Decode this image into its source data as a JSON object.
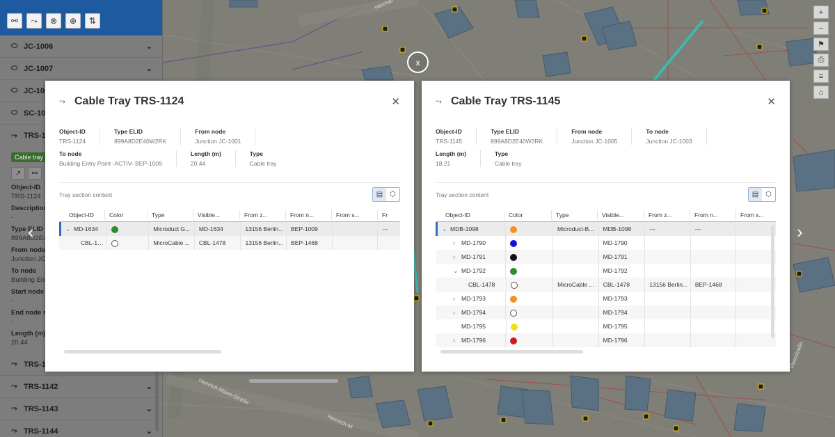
{
  "toolbar": {
    "icons": [
      "binoculars-icon",
      "route-icon",
      "cancel-icon",
      "zoom-in-icon",
      "sort-icon"
    ]
  },
  "sidebar": {
    "items_top": [
      {
        "label": "JC-1006"
      },
      {
        "label": "JC-1007"
      },
      {
        "label": "JC-100"
      },
      {
        "label": "SC-108"
      }
    ],
    "active_item": {
      "label": "TRS-11",
      "badge": "Cable tray"
    },
    "fields": [
      {
        "label": "Object-ID",
        "value": "TRS-1124"
      },
      {
        "label": "Description",
        "value": "-"
      },
      {
        "label": "Type ELID",
        "value": "899A8D2E4"
      },
      {
        "label": "From node",
        "value": "Junction JC"
      },
      {
        "label": "To node",
        "value": "Building Ent"
      },
      {
        "label": "Start node s",
        "value": "-"
      },
      {
        "label": "End node si",
        "value": "-"
      },
      {
        "label": "Length (m)",
        "value": "20.44"
      }
    ],
    "items_bottom": [
      {
        "label": "TRS-11"
      },
      {
        "label": "TRS-1142"
      },
      {
        "label": "TRS-1143"
      },
      {
        "label": "TRS-1144"
      }
    ]
  },
  "map": {
    "close_label": "x",
    "streets": [
      "Herman",
      "Heinrich-Mann-Straße",
      "Heinrich-M",
      "Pleinstraße"
    ]
  },
  "dialog1": {
    "title": "Cable Tray TRS-1124",
    "props": [
      {
        "k": "Object-ID",
        "v": "TRS-1124"
      },
      {
        "k": "Type ELID",
        "v": "899A8D2E40W2RK"
      },
      {
        "k": "From node",
        "v": "Junction JC-1001"
      },
      {
        "k": "To node",
        "v": "Building Entry Point -ACTIV- BEP-1009"
      },
      {
        "k": "Length (m)",
        "v": "20.44"
      },
      {
        "k": "Type",
        "v": "Cable tray"
      }
    ],
    "section_label": "Tray section content",
    "columns": [
      "Object-ID",
      "Color",
      "Type",
      "Visible...",
      "From z...",
      "From n...",
      "From s...",
      "Fr"
    ],
    "rows": [
      {
        "id": "MD-1634",
        "color": "#2e8b2e",
        "type": "Microduct G...",
        "visible": "MD-1634",
        "fromz": "13156 Berlin...",
        "fromn": "BEP-1009",
        "froms": "",
        "fr": "---",
        "toggle": "⌄"
      },
      {
        "id": "CBL-1478",
        "color": "#ffffff",
        "type": "MicroCable ...",
        "visible": "CBL-1478",
        "fromz": "13156 Berlin...",
        "fromn": "BEP-1468",
        "froms": "",
        "fr": "",
        "toggle": ""
      }
    ]
  },
  "dialog2": {
    "title": "Cable Tray TRS-1145",
    "props": [
      {
        "k": "Object-ID",
        "v": "TRS-1145"
      },
      {
        "k": "Type ELID",
        "v": "899A8D2E40W2RK"
      },
      {
        "k": "From node",
        "v": "Junction JC-1005"
      },
      {
        "k": "To node",
        "v": "Junction JC-1003"
      },
      {
        "k": "Length (m)",
        "v": "18.21"
      },
      {
        "k": "Type",
        "v": "Cable tray"
      }
    ],
    "section_label": "Tray section content",
    "columns": [
      "Object-ID",
      "Color",
      "Type",
      "Visible...",
      "From z...",
      "From n...",
      "From s..."
    ],
    "rows": [
      {
        "id": "MDB-1098",
        "color": "#f0922a",
        "type": "Microduct-B...",
        "visible": "MDB-1098",
        "fromz": "---",
        "fromn": "---",
        "froms": "",
        "toggle": "⌄"
      },
      {
        "id": "MD-1790",
        "color": "#1212e0",
        "type": "",
        "visible": "MD-1790",
        "fromz": "",
        "fromn": "",
        "froms": "",
        "toggle": "›"
      },
      {
        "id": "MD-1791",
        "color": "#111111",
        "type": "",
        "visible": "MD-1791",
        "fromz": "",
        "fromn": "",
        "froms": "",
        "toggle": "›"
      },
      {
        "id": "MD-1792",
        "color": "#2e8b2e",
        "type": "",
        "visible": "MD-1792",
        "fromz": "",
        "fromn": "",
        "froms": "",
        "toggle": "⌄"
      },
      {
        "id": "CBL-1478",
        "color": "#ffffff",
        "type": "MicroCable ...",
        "visible": "CBL-1478",
        "fromz": "13156 Berlin...",
        "fromn": "BEP-1468",
        "froms": "",
        "toggle": ""
      },
      {
        "id": "MD-1793",
        "color": "#f0922a",
        "type": "",
        "visible": "MD-1793",
        "fromz": "",
        "fromn": "",
        "froms": "",
        "toggle": "›"
      },
      {
        "id": "MD-1794",
        "color": "#ffffff",
        "type": "",
        "visible": "MD-1794",
        "fromz": "",
        "fromn": "",
        "froms": "",
        "toggle": "›"
      },
      {
        "id": "MD-1795",
        "color": "#f2de1a",
        "type": "",
        "visible": "MD-1795",
        "fromz": "",
        "fromn": "",
        "froms": "",
        "toggle": ""
      },
      {
        "id": "MD-1796",
        "color": "#c81e1e",
        "type": "",
        "visible": "MD-1796",
        "fromz": "",
        "fromn": "",
        "froms": "",
        "toggle": "›"
      }
    ]
  },
  "map_tools": [
    "zoom-in-icon",
    "zoom-out-icon",
    "bookmark-icon",
    "print-icon",
    "layers-icon",
    "home-icon"
  ]
}
